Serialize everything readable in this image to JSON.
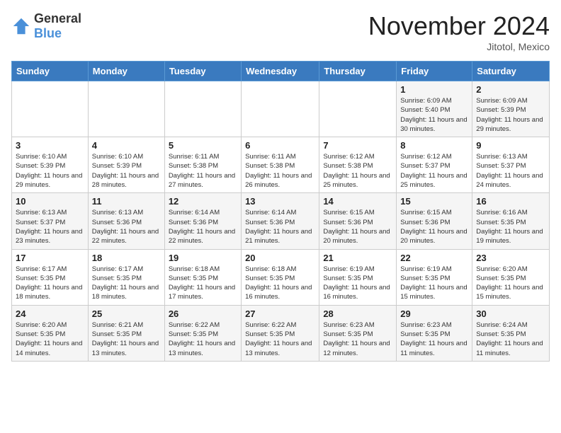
{
  "logo": {
    "general": "General",
    "blue": "Blue"
  },
  "title": "November 2024",
  "location": "Jitotol, Mexico",
  "days_header": [
    "Sunday",
    "Monday",
    "Tuesday",
    "Wednesday",
    "Thursday",
    "Friday",
    "Saturday"
  ],
  "weeks": [
    [
      {
        "day": "",
        "info": ""
      },
      {
        "day": "",
        "info": ""
      },
      {
        "day": "",
        "info": ""
      },
      {
        "day": "",
        "info": ""
      },
      {
        "day": "",
        "info": ""
      },
      {
        "day": "1",
        "info": "Sunrise: 6:09 AM\nSunset: 5:40 PM\nDaylight: 11 hours and 30 minutes."
      },
      {
        "day": "2",
        "info": "Sunrise: 6:09 AM\nSunset: 5:39 PM\nDaylight: 11 hours and 29 minutes."
      }
    ],
    [
      {
        "day": "3",
        "info": "Sunrise: 6:10 AM\nSunset: 5:39 PM\nDaylight: 11 hours and 29 minutes."
      },
      {
        "day": "4",
        "info": "Sunrise: 6:10 AM\nSunset: 5:39 PM\nDaylight: 11 hours and 28 minutes."
      },
      {
        "day": "5",
        "info": "Sunrise: 6:11 AM\nSunset: 5:38 PM\nDaylight: 11 hours and 27 minutes."
      },
      {
        "day": "6",
        "info": "Sunrise: 6:11 AM\nSunset: 5:38 PM\nDaylight: 11 hours and 26 minutes."
      },
      {
        "day": "7",
        "info": "Sunrise: 6:12 AM\nSunset: 5:38 PM\nDaylight: 11 hours and 25 minutes."
      },
      {
        "day": "8",
        "info": "Sunrise: 6:12 AM\nSunset: 5:37 PM\nDaylight: 11 hours and 25 minutes."
      },
      {
        "day": "9",
        "info": "Sunrise: 6:13 AM\nSunset: 5:37 PM\nDaylight: 11 hours and 24 minutes."
      }
    ],
    [
      {
        "day": "10",
        "info": "Sunrise: 6:13 AM\nSunset: 5:37 PM\nDaylight: 11 hours and 23 minutes."
      },
      {
        "day": "11",
        "info": "Sunrise: 6:13 AM\nSunset: 5:36 PM\nDaylight: 11 hours and 22 minutes."
      },
      {
        "day": "12",
        "info": "Sunrise: 6:14 AM\nSunset: 5:36 PM\nDaylight: 11 hours and 22 minutes."
      },
      {
        "day": "13",
        "info": "Sunrise: 6:14 AM\nSunset: 5:36 PM\nDaylight: 11 hours and 21 minutes."
      },
      {
        "day": "14",
        "info": "Sunrise: 6:15 AM\nSunset: 5:36 PM\nDaylight: 11 hours and 20 minutes."
      },
      {
        "day": "15",
        "info": "Sunrise: 6:15 AM\nSunset: 5:36 PM\nDaylight: 11 hours and 20 minutes."
      },
      {
        "day": "16",
        "info": "Sunrise: 6:16 AM\nSunset: 5:35 PM\nDaylight: 11 hours and 19 minutes."
      }
    ],
    [
      {
        "day": "17",
        "info": "Sunrise: 6:17 AM\nSunset: 5:35 PM\nDaylight: 11 hours and 18 minutes."
      },
      {
        "day": "18",
        "info": "Sunrise: 6:17 AM\nSunset: 5:35 PM\nDaylight: 11 hours and 18 minutes."
      },
      {
        "day": "19",
        "info": "Sunrise: 6:18 AM\nSunset: 5:35 PM\nDaylight: 11 hours and 17 minutes."
      },
      {
        "day": "20",
        "info": "Sunrise: 6:18 AM\nSunset: 5:35 PM\nDaylight: 11 hours and 16 minutes."
      },
      {
        "day": "21",
        "info": "Sunrise: 6:19 AM\nSunset: 5:35 PM\nDaylight: 11 hours and 16 minutes."
      },
      {
        "day": "22",
        "info": "Sunrise: 6:19 AM\nSunset: 5:35 PM\nDaylight: 11 hours and 15 minutes."
      },
      {
        "day": "23",
        "info": "Sunrise: 6:20 AM\nSunset: 5:35 PM\nDaylight: 11 hours and 15 minutes."
      }
    ],
    [
      {
        "day": "24",
        "info": "Sunrise: 6:20 AM\nSunset: 5:35 PM\nDaylight: 11 hours and 14 minutes."
      },
      {
        "day": "25",
        "info": "Sunrise: 6:21 AM\nSunset: 5:35 PM\nDaylight: 11 hours and 13 minutes."
      },
      {
        "day": "26",
        "info": "Sunrise: 6:22 AM\nSunset: 5:35 PM\nDaylight: 11 hours and 13 minutes."
      },
      {
        "day": "27",
        "info": "Sunrise: 6:22 AM\nSunset: 5:35 PM\nDaylight: 11 hours and 13 minutes."
      },
      {
        "day": "28",
        "info": "Sunrise: 6:23 AM\nSunset: 5:35 PM\nDaylight: 11 hours and 12 minutes."
      },
      {
        "day": "29",
        "info": "Sunrise: 6:23 AM\nSunset: 5:35 PM\nDaylight: 11 hours and 11 minutes."
      },
      {
        "day": "30",
        "info": "Sunrise: 6:24 AM\nSunset: 5:35 PM\nDaylight: 11 hours and 11 minutes."
      }
    ]
  ]
}
